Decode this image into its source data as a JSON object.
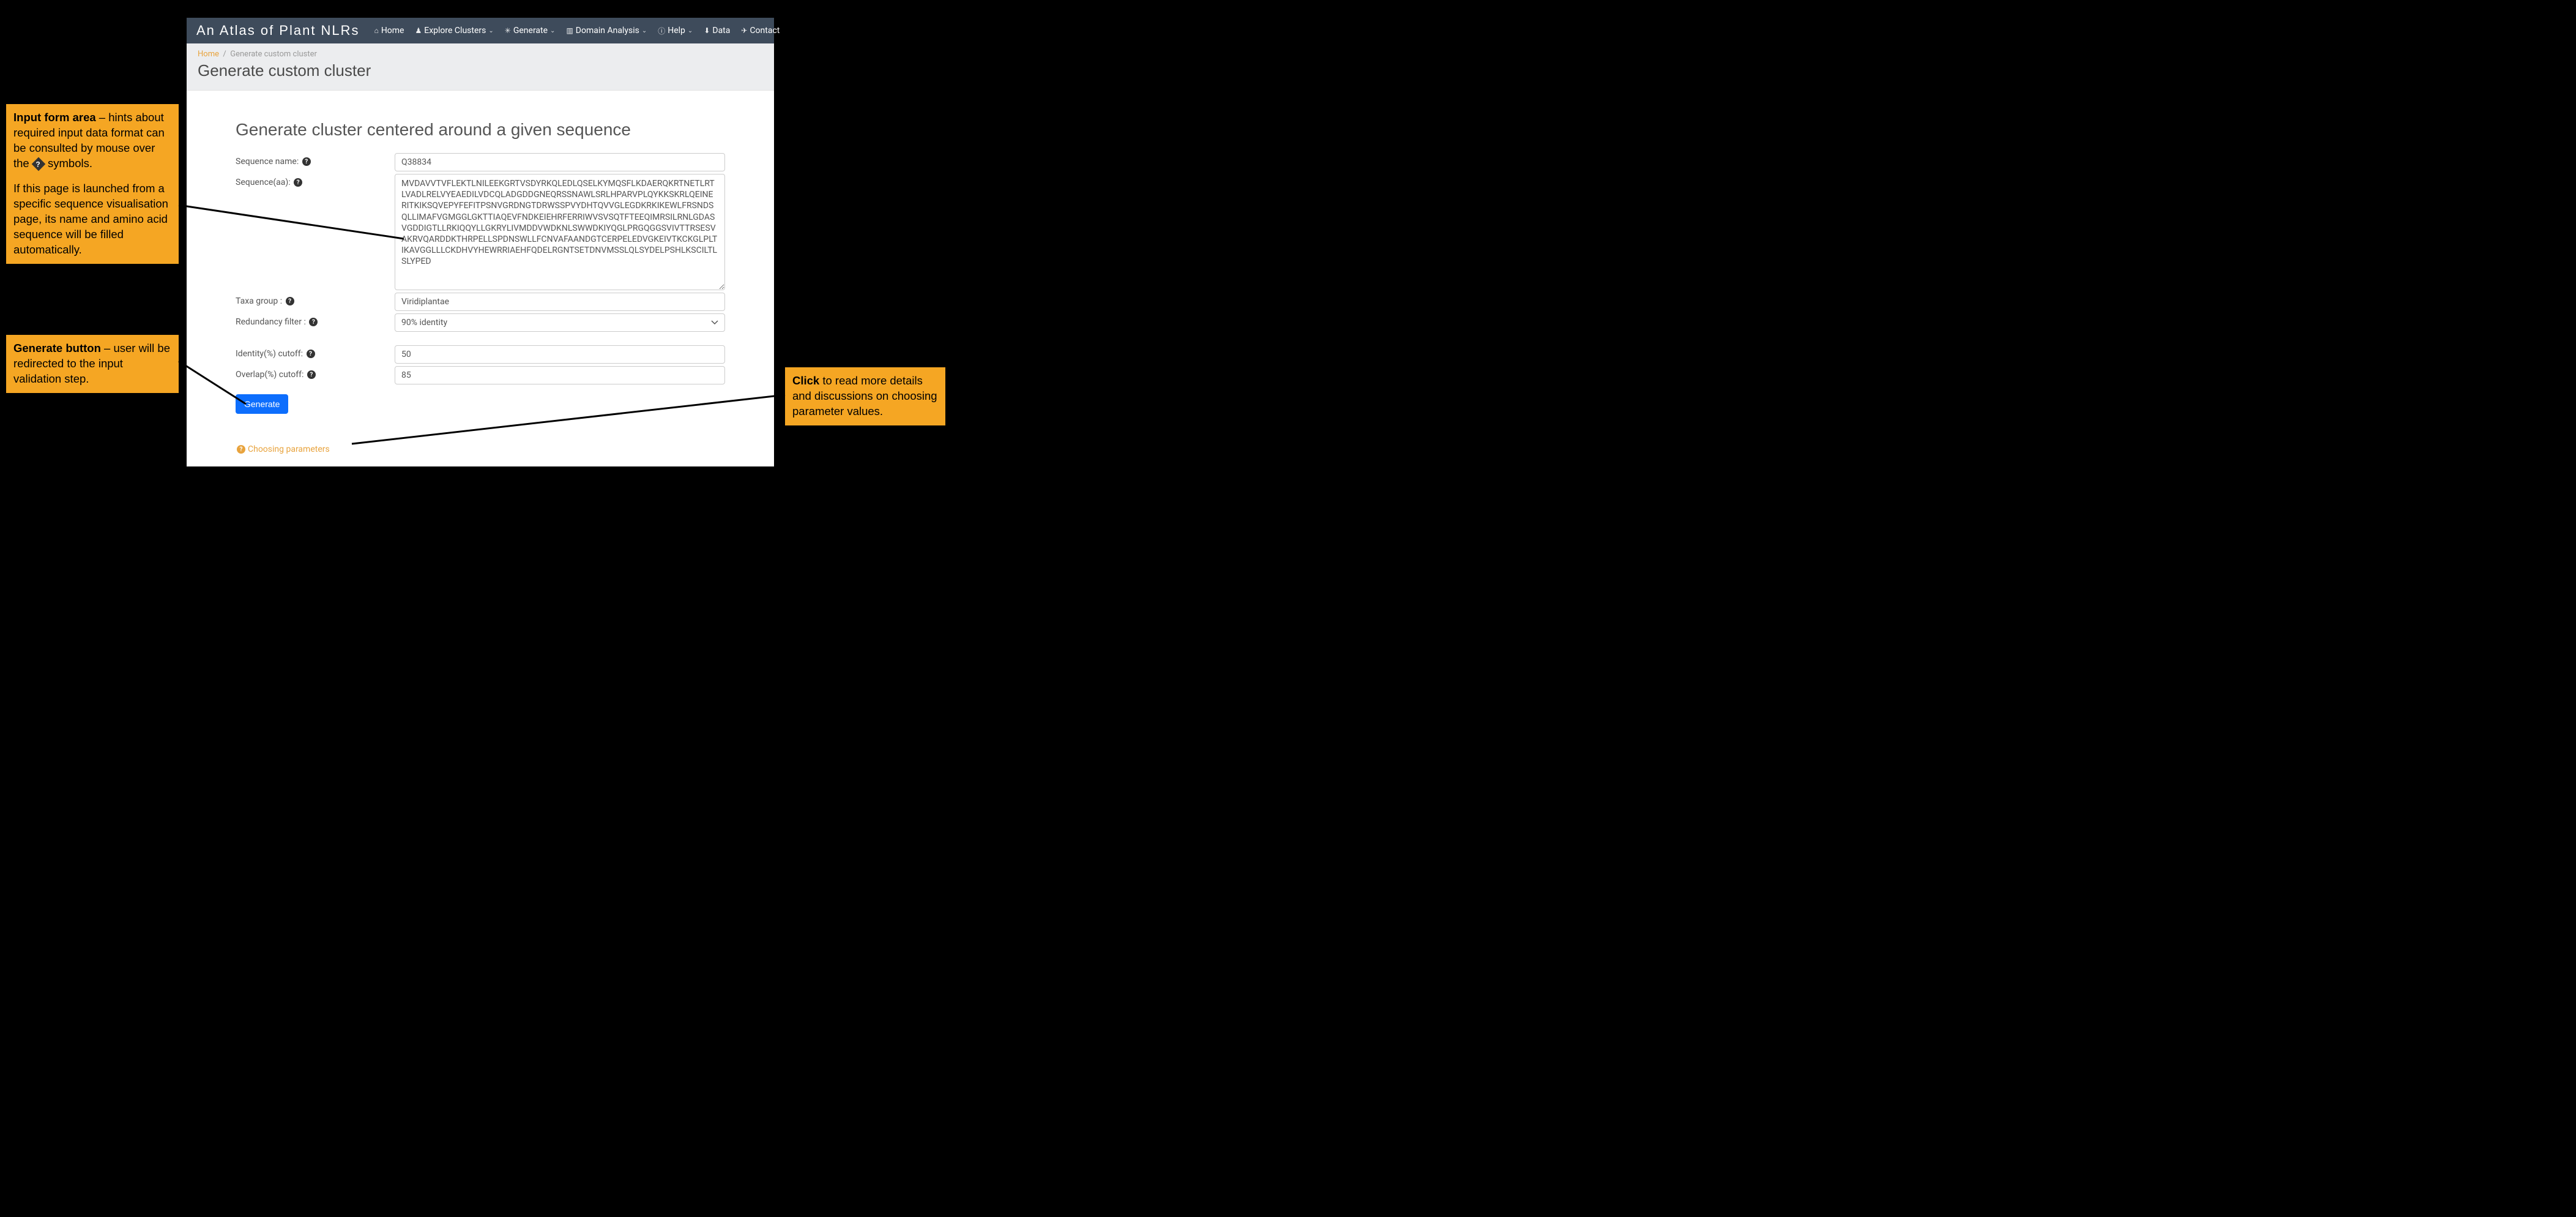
{
  "brand": "An Atlas of Plant NLRs",
  "nav": {
    "home": "Home",
    "explore": "Explore Clusters",
    "generate": "Generate",
    "domain": "Domain Analysis",
    "help": "Help",
    "data": "Data",
    "contact": "Contact"
  },
  "breadcrumb": {
    "home": "Home",
    "current": "Generate custom cluster"
  },
  "page_title": "Generate custom cluster",
  "main_heading": "Generate cluster centered around a given sequence",
  "form": {
    "seq_name_label": "Sequence name:",
    "seq_name_value": "Q38834",
    "seq_aa_label": "Sequence(aa):",
    "seq_aa_value": "MVDAVVTVFLEKTLNILEEKGRTVSDYRKQLEDLQSELKYMQSFLKDAERQKRTNETLRTLVADLRELVYEAEDILVDCQLADGDDGNEQRSSNAWLSRLHPARVPLQYKKSKRLQEINERITKIKSQVEPYFEFITPSNVGRDNGTDRWSSPVYDHTQVVGLEGDKRKIKEWLFRSNDSQLLIMAFVGMGGLGKTTIAQEVFNDKEIEHRFERRIWVSVSQTFTEEQIMRSILRNLGDASVGDDIGTLLRKIQQYLLGKRYLIVMDDVWDKNLSWWDKIYQGLPRGQGGSVIVTTRSESVAKRVQARDDKTHRPELLSPDNSWLLFCNVAFAANDGTCERPELEDVGKEIVTKCKGLPLTIKAVGGLLLCKDHVYHEWRRIAEHFQDELRGNTSETDNVMSSLQLSYDELPSHLKSCILTLSLYPED",
    "taxa_label": "Taxa group :",
    "taxa_value": "Viridiplantae",
    "redundancy_label": "Redundancy filter :",
    "redundancy_value": "90% identity",
    "identity_label": "Identity(%) cutoff:",
    "identity_value": "50",
    "overlap_label": "Overlap(%) cutoff:",
    "overlap_value": "85",
    "generate_btn": "Generate",
    "info_link": "Choosing parameters"
  },
  "callouts": {
    "c1_strong": "Input form area",
    "c1_rest": " – hints about required input data format can be consulted by mouse over the ",
    "c1_tail": " symbols.",
    "c1_p2": "If this page is launched from a specific sequence visualisation page, its name and amino acid sequence will be filled automatically.",
    "c2_strong": "Generate button",
    "c2_rest": " – user will be redirected to the input validation step.",
    "c3_strong": "Click",
    "c3_rest": " to read more details and discussions on choosing parameter values."
  }
}
